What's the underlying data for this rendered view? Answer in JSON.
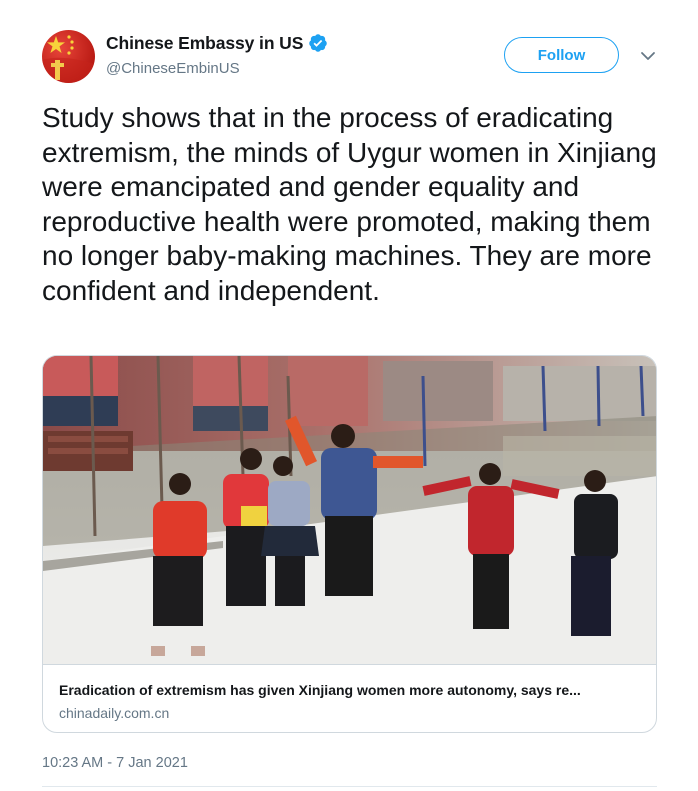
{
  "author": {
    "display_name": "Chinese Embassy in US",
    "handle": "@ChineseEmbinUS",
    "verified": true,
    "avatar_icon": "china-flag-avatar"
  },
  "follow_label": "Follow",
  "tweet_text": "Study shows that in the process of eradicating extremism, the minds of Uygur women in Xinjiang were emancipated and gender equality and reproductive health were promoted, making them no longer baby-making machines. They are more confident and independent.",
  "link_card": {
    "title": "Eradication of extremism has given Xinjiang women more autonomy, says re...",
    "domain": "chinadaily.com.cn"
  },
  "timestamp": "10:23 AM - 7 Jan 2021",
  "colors": {
    "accent": "#1da1f2",
    "text": "#14171a",
    "secondary_text": "#657786",
    "border": "#d0d8de"
  }
}
